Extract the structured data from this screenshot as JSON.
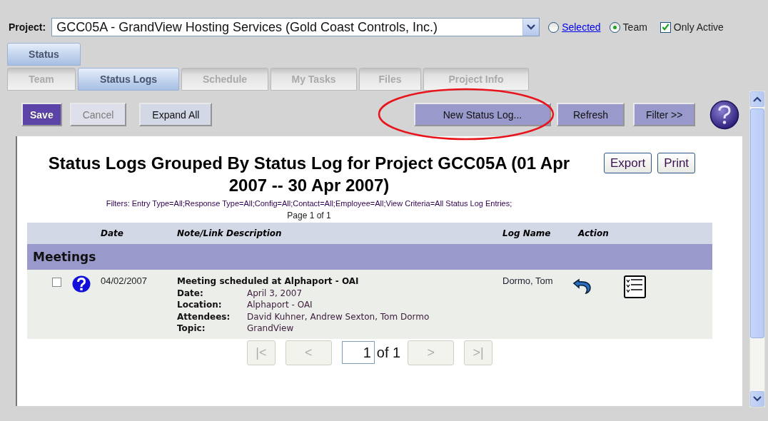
{
  "project": {
    "label": "Project:",
    "value": "GCC05A - GrandView Hosting Services (Gold Coast Controls, Inc.)"
  },
  "scope": [
    {
      "label": "Selected",
      "kind": "link",
      "selected": false
    },
    {
      "label": "Team",
      "kind": "plain",
      "selected": true
    }
  ],
  "only_active": {
    "label": "Only Active",
    "checked": true
  },
  "top_tabs": [
    {
      "label": "Status",
      "selected": true
    }
  ],
  "tabs": [
    {
      "label": "Team",
      "selected": false
    },
    {
      "label": "Status Logs",
      "selected": true
    },
    {
      "label": "Schedule",
      "selected": false
    },
    {
      "label": "My Tasks",
      "selected": false
    },
    {
      "label": "Files",
      "selected": false
    },
    {
      "label": "Project Info",
      "selected": false
    }
  ],
  "toolbar": {
    "left": [
      {
        "label": "Save",
        "kind": "primary",
        "disabled": false
      },
      {
        "label": "Cancel",
        "kind": "normal",
        "disabled": true
      },
      {
        "label": "Expand All",
        "kind": "normal",
        "disabled": false
      }
    ],
    "right": [
      {
        "label": "New Status Log...",
        "kind": "accent",
        "disabled": false,
        "circled": true
      },
      {
        "label": "Refresh",
        "kind": "accent",
        "disabled": false,
        "circled": false
      },
      {
        "label": "Filter >>",
        "kind": "accent",
        "disabled": false,
        "circled": false
      }
    ]
  },
  "report": {
    "title": "Status Logs Grouped By Status Log for Project GCC05A (01 Apr 2007 -- 30 Apr 2007)",
    "buttons": [
      "Export",
      "Print"
    ],
    "filters": "Filters: Entry Type=All;Response Type=All;Config=All;Contact=All;Employee=All;View Criteria=All Status Log Entries;",
    "page_info": "Page 1 of 1",
    "columns": [
      "Date",
      "Note/Link Description",
      "Log Name",
      "Action"
    ],
    "groups": [
      {
        "name": "Meetings",
        "rows": [
          {
            "checked": false,
            "date": "04/02/2007",
            "title": "Meeting scheduled at Alphaport - OAI",
            "fields": [
              {
                "label": "Date:",
                "value": "April 3, 2007"
              },
              {
                "label": "Location:",
                "value": "Alphaport - OAI"
              },
              {
                "label": "Attendees:",
                "value": "David Kuhner, Andrew Sexton, Tom Dormo"
              },
              {
                "label": "Topic:",
                "value": "GrandView"
              }
            ],
            "log_name": "Dormo, Tom"
          }
        ]
      }
    ]
  },
  "pager": {
    "first": {
      "label": "|<",
      "disabled": true
    },
    "prev": {
      "label": "<",
      "disabled": true
    },
    "page": "1",
    "of": "of 1",
    "next": {
      "label": ">",
      "disabled": true
    },
    "last": {
      "label": ">|",
      "disabled": true
    }
  }
}
